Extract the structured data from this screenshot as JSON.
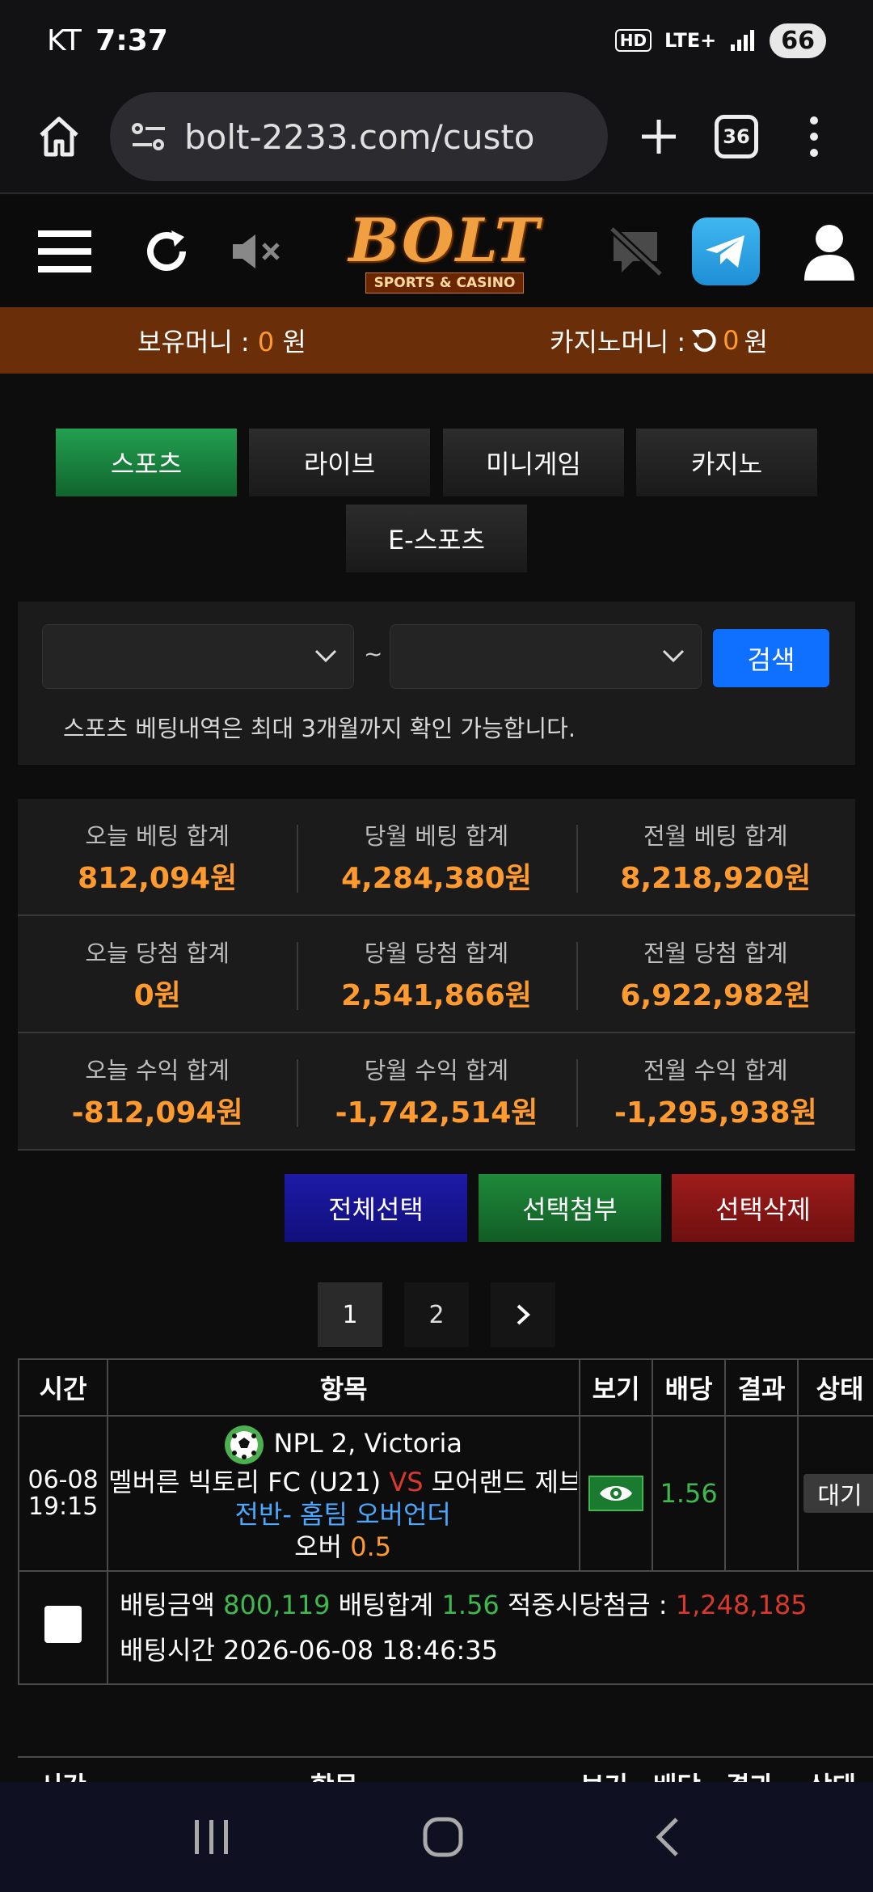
{
  "status_bar": {
    "carrier": "KT",
    "time": "7:37",
    "network": "LTE+",
    "battery": "66"
  },
  "browser": {
    "url": "bolt-2233.com/custo",
    "tab_count": "36"
  },
  "site": {
    "logo_text": "BOLT",
    "logo_sub": "SPORTS & CASINO"
  },
  "money": {
    "own_label": "보유머니 : ",
    "own_value": "0",
    "own_unit": " 원",
    "casino_label": "카지노머니 : ",
    "casino_value": "0",
    "casino_unit": " 원"
  },
  "categories": [
    "스포츠",
    "라이브",
    "미니게임",
    "카지노",
    "E-스포츠"
  ],
  "search": {
    "tilde": "~",
    "button": "검색",
    "note": "스포츠 베팅내역은 최대 3개월까지 확인 가능합니다."
  },
  "summary": [
    [
      {
        "label": "오늘 베팅 합계",
        "value": "812,094원"
      },
      {
        "label": "당월 베팅 합계",
        "value": "4,284,380원"
      },
      {
        "label": "전월 베팅 합계",
        "value": "8,218,920원"
      }
    ],
    [
      {
        "label": "오늘 당첨 합계",
        "value": "0원"
      },
      {
        "label": "당월 당첨 합계",
        "value": "2,541,866원"
      },
      {
        "label": "전월 당첨 합계",
        "value": "6,922,982원"
      }
    ],
    [
      {
        "label": "오늘 수익 합계",
        "value": "-812,094원"
      },
      {
        "label": "당월 수익 합계",
        "value": "-1,742,514원"
      },
      {
        "label": "전월 수익 합계",
        "value": "-1,295,938원"
      }
    ]
  ],
  "actions": {
    "select_all": "전체선택",
    "attach": "선택첨부",
    "delete": "선택삭제"
  },
  "pagination": {
    "pages": [
      "1",
      "2"
    ],
    "next": "›"
  },
  "table": {
    "headers": [
      "시간",
      "항목",
      "보기",
      "배당",
      "결과",
      "상태"
    ],
    "row": {
      "date": "06-08",
      "time": "19:15",
      "league": "NPL 2, Victoria",
      "home": "멜버른 빅토리 FC (U21)",
      "vs": "VS",
      "away": "모어랜드 제브라스",
      "market": "전반- 홈팀 오버언더",
      "pick_label": "오버",
      "pick_value": "0.5",
      "odds": "1.56",
      "status": "대기"
    },
    "footer": {
      "amount_label": "배팅금액",
      "amount_value": "800,119",
      "total_odds_label": "배팅합계",
      "total_odds_value": "1.56",
      "win_label": "적중시당첨금 :",
      "win_value": "1,248,185",
      "time_label": "배팅시간",
      "time_value": "2026-06-08 18:46:35"
    },
    "second_headers": [
      "시간",
      "항목",
      "보기",
      "배당",
      "결과",
      "상태"
    ]
  },
  "colors": {
    "accent_orange": "#ff9a2e",
    "money_bar": "#6a2e08",
    "search_blue": "#0f6fff"
  }
}
